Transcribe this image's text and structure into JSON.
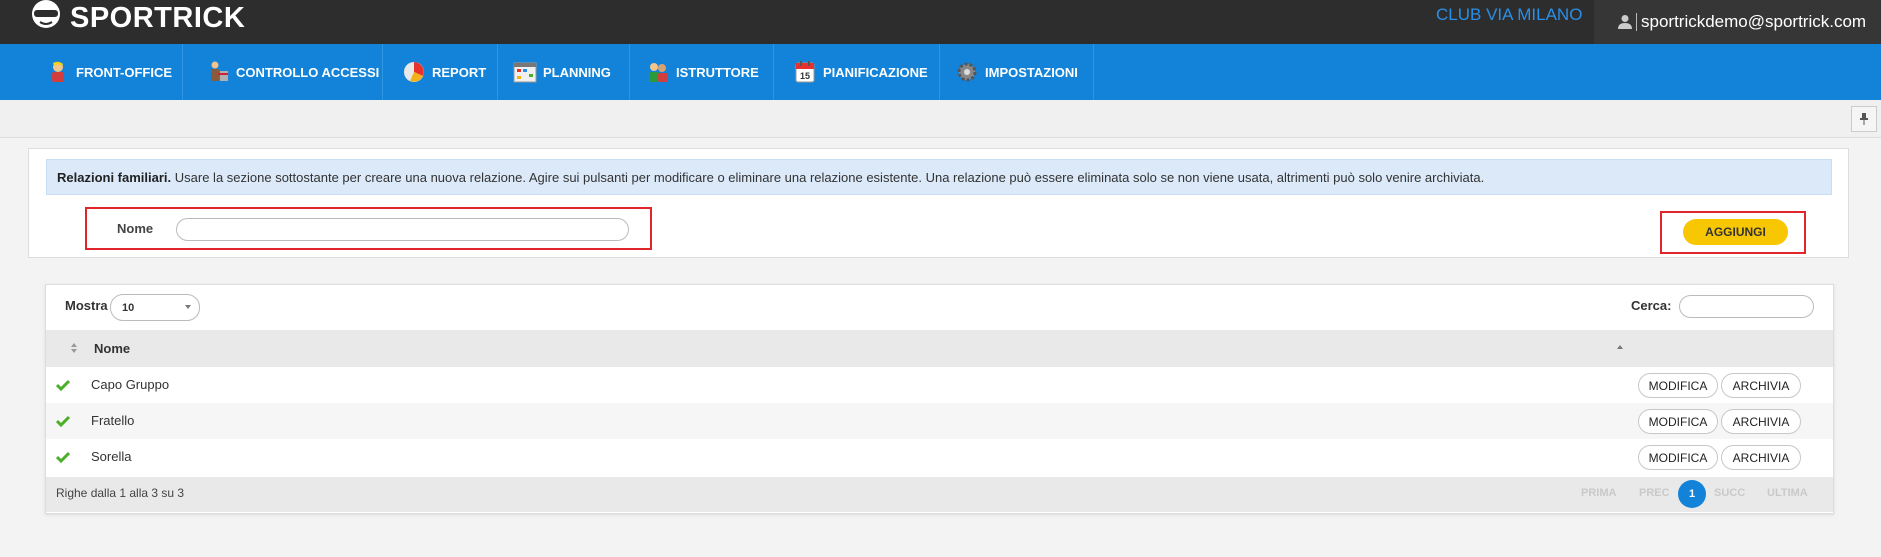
{
  "header": {
    "logo_text": "SPORTRICK",
    "club": "CLUB VIA MILANO",
    "user_email": "sportrickdemo@sportrick.com"
  },
  "nav": {
    "items": [
      {
        "label": "FRONT-OFFICE",
        "icon": "person-icon"
      },
      {
        "label": "CONTROLLO ACCESSI",
        "icon": "turnstile-icon"
      },
      {
        "label": "REPORT",
        "icon": "pie-chart-icon"
      },
      {
        "label": "PLANNING",
        "icon": "calendar-grid-icon"
      },
      {
        "label": "ISTRUTTORE",
        "icon": "instructor-icon"
      },
      {
        "label": "PIANIFICAZIONE",
        "icon": "calendar-icon"
      },
      {
        "label": "IMPOSTAZIONI",
        "icon": "gear-icon",
        "active": true
      }
    ]
  },
  "info": {
    "title": "Relazioni familiari.",
    "text": " Usare la sezione sottostante per creare una nuova relazione. Agire sui pulsanti per modificare o eliminare una relazione esistente. Una relazione può essere eliminata solo se non viene usata, altrimenti può solo venire archiviata."
  },
  "form": {
    "nome_label": "Nome",
    "nome_value": "",
    "add_label": "AGGIUNGI"
  },
  "table": {
    "mostra_label": "Mostra",
    "page_size": "10",
    "cerca_label": "Cerca:",
    "search_value": "",
    "column_header": "Nome",
    "rows": [
      {
        "nome": "Capo Gruppo",
        "edit": "MODIFICA",
        "archive": "ARCHIVIA"
      },
      {
        "nome": "Fratello",
        "edit": "MODIFICA",
        "archive": "ARCHIVIA"
      },
      {
        "nome": "Sorella",
        "edit": "MODIFICA",
        "archive": "ARCHIVIA"
      }
    ],
    "footer_info": "Righe dalla 1 alla 3 su 3",
    "pagination": {
      "first": "PRIMA",
      "prev": "PREC",
      "current": "1",
      "next": "SUCC",
      "last": "ULTIMA"
    }
  },
  "colors": {
    "nav_blue": "#1283d9",
    "accent_yellow": "#f7c703",
    "highlight_red": "#e0262a",
    "check_green": "#4caf2a"
  }
}
